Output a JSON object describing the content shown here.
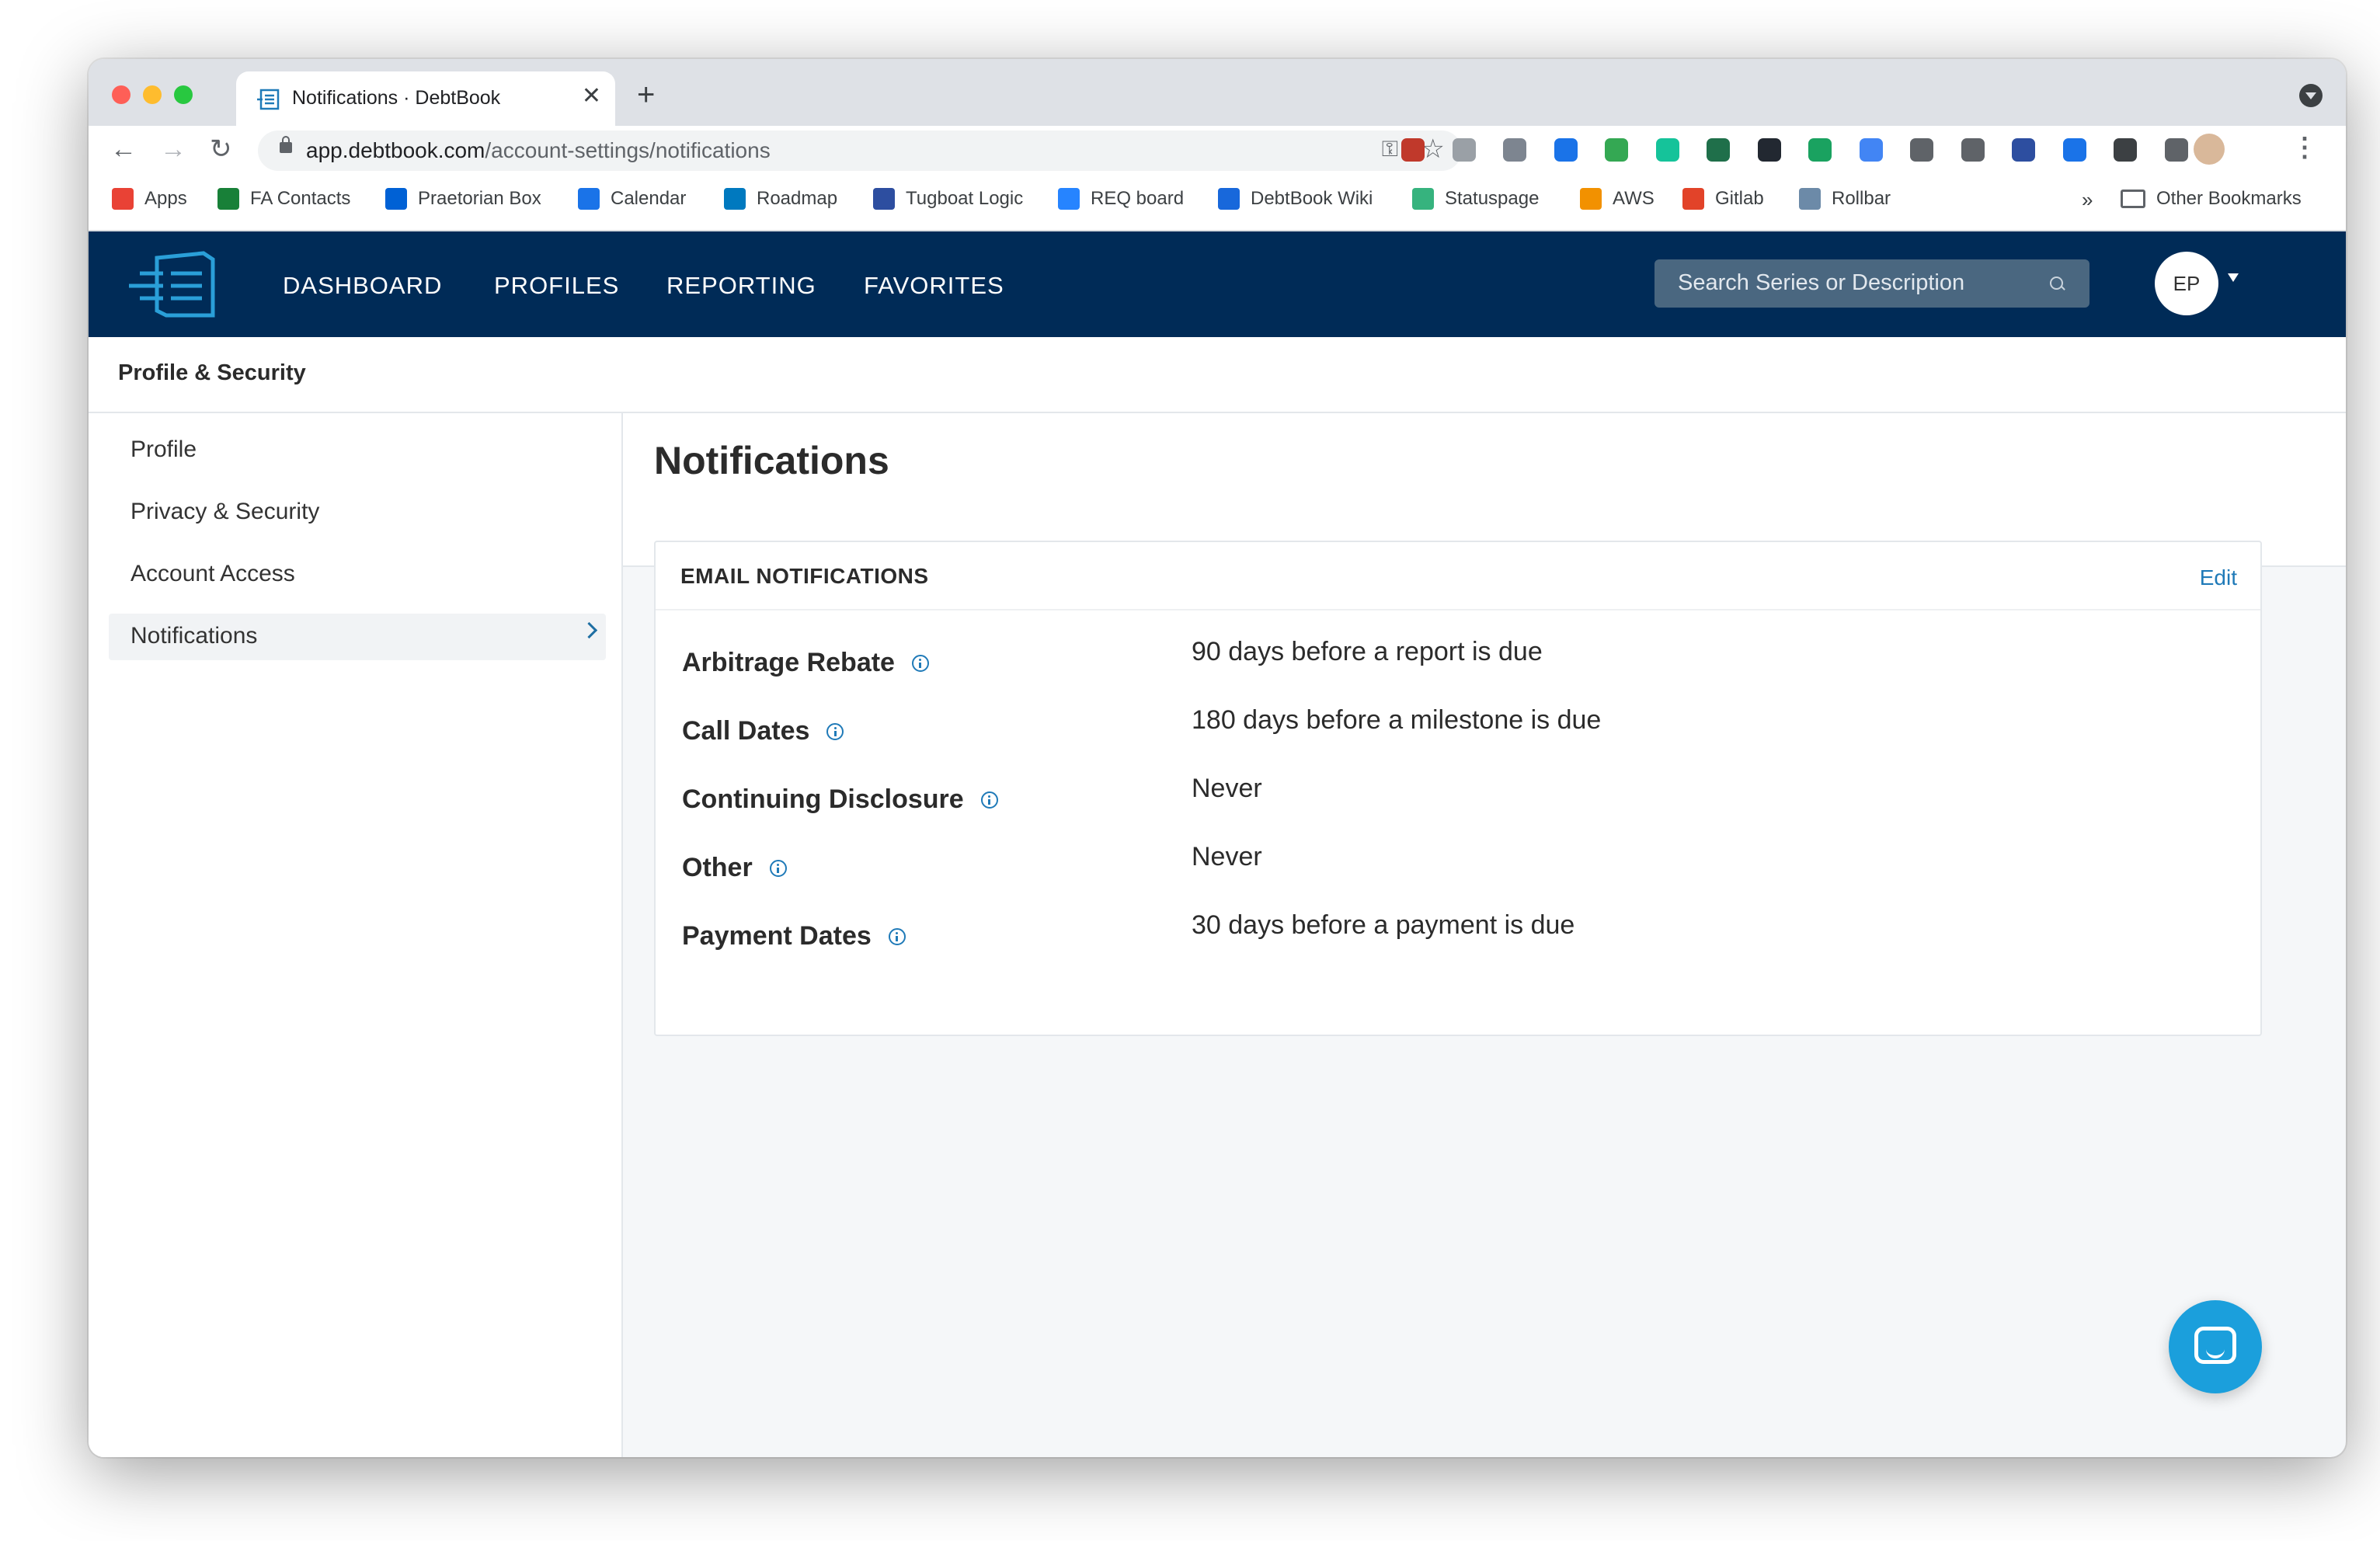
{
  "browser": {
    "tab_title": "Notifications · DebtBook",
    "new_tab": "+",
    "close": "✕",
    "url_domain": "app.debtbook.com",
    "url_path": "/account-settings/notifications",
    "extensions": [
      "eye-ext",
      "cashier-ext",
      "gear-ext",
      "v-ext",
      "drive-ext",
      "grammarly-ext",
      "s-ext",
      "react-ext",
      "green-ext",
      "blue-ext",
      "wordpress-ext",
      "code-ext",
      "shield-ext",
      "tab-ext",
      "brave-ext",
      "puzzle-ext",
      "profile-ext"
    ]
  },
  "bookmarks": [
    {
      "label": "Apps",
      "icon": "apps-grid-icon",
      "color": "#e94235"
    },
    {
      "label": "FA Contacts",
      "icon": "sheets-icon",
      "color": "#188038"
    },
    {
      "label": "Praetorian Box",
      "icon": "box-icon",
      "color": "#0061d5"
    },
    {
      "label": "Calendar",
      "icon": "calendar-icon",
      "color": "#1a73e8"
    },
    {
      "label": "Roadmap",
      "icon": "trello-icon",
      "color": "#0079bf"
    },
    {
      "label": "Tugboat Logic",
      "icon": "shield-icon",
      "color": "#2d4ea0"
    },
    {
      "label": "REQ board",
      "icon": "diamond-icon",
      "color": "#2684ff"
    },
    {
      "label": "DebtBook Wiki",
      "icon": "confluence-icon",
      "color": "#1868db"
    },
    {
      "label": "Statuspage",
      "icon": "statuspage-icon",
      "color": "#36b37e"
    },
    {
      "label": "AWS",
      "icon": "aws-icon",
      "color": "#f29100"
    },
    {
      "label": "Gitlab",
      "icon": "gitlab-icon",
      "color": "#e24329"
    },
    {
      "label": "Rollbar",
      "icon": "rollbar-icon",
      "color": "#6c8aa8"
    }
  ],
  "bookmarks_more": "»",
  "other_bookmarks": "Other Bookmarks",
  "nav": {
    "links": [
      "DASHBOARD",
      "PROFILES",
      "REPORTING",
      "FAVORITES"
    ],
    "search_placeholder": "Search Series or Description",
    "avatar_initials": "EP"
  },
  "section_title": "Profile & Security",
  "sidebar": {
    "items": [
      {
        "label": "Profile",
        "active": false
      },
      {
        "label": "Privacy & Security",
        "active": false
      },
      {
        "label": "Account Access",
        "active": false
      },
      {
        "label": "Notifications",
        "active": true
      }
    ]
  },
  "main": {
    "title": "Notifications",
    "card": {
      "title": "EMAIL NOTIFICATIONS",
      "edit_label": "Edit",
      "rows": [
        {
          "label": "Arbitrage Rebate",
          "value": "90 days before a report is due"
        },
        {
          "label": "Call Dates",
          "value": "180 days before a milestone is due"
        },
        {
          "label": "Continuing Disclosure",
          "value": "Never"
        },
        {
          "label": "Other",
          "value": "Never"
        },
        {
          "label": "Payment Dates",
          "value": "30 days before a payment is due"
        }
      ]
    }
  },
  "colors": {
    "header_bg": "#002b57",
    "accent": "#1f7ab8",
    "chat_button": "#1b9fdc"
  }
}
